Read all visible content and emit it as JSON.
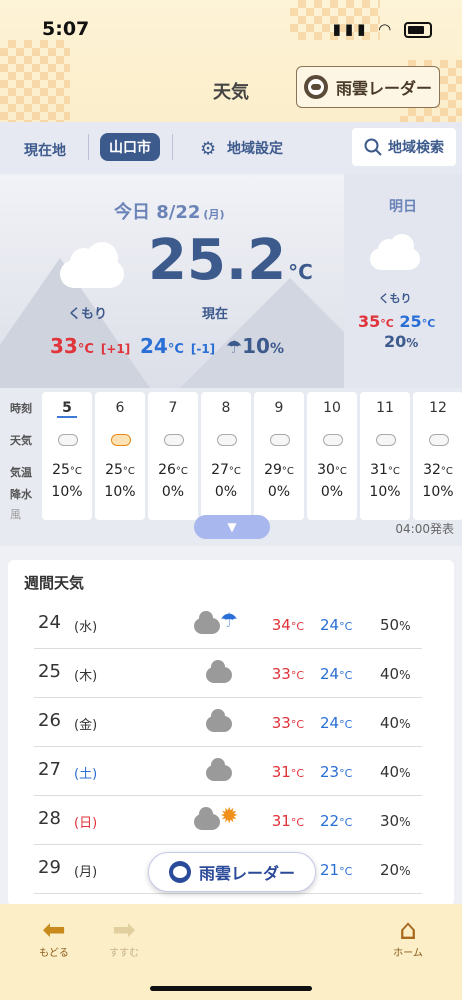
{
  "status": {
    "time": "5:07"
  },
  "header": {
    "title": "天気",
    "radar_label": "雨雲レーダー"
  },
  "location_bar": {
    "current": "現在地",
    "selected": "山口市",
    "settings": "地域設定",
    "search": "地域検索"
  },
  "today": {
    "date_label": "今日 8/22",
    "dow": "(月)",
    "weather": "くもり",
    "temp": "25.2",
    "temp_unit": "°C",
    "now_label": "現在",
    "high": "33",
    "high_diff": "[+1]",
    "low": "24",
    "low_diff": "[-1]",
    "pop": "10",
    "unit_c": "°C",
    "unit_pct": "%"
  },
  "tomorrow": {
    "label": "明日",
    "weather": "くもり",
    "high": "35",
    "low": "25",
    "pop": "20",
    "unit_c": "°C",
    "unit_pct": "%"
  },
  "hourly": {
    "row_labels": {
      "hour": "時刻",
      "weather": "天気",
      "temp": "気温",
      "rain": "降水",
      "wind": "風"
    },
    "hours": [
      {
        "hour": "5",
        "temp": "25",
        "rain": "10",
        "icon": "cloud-icon"
      },
      {
        "hour": "6",
        "temp": "25",
        "rain": "10",
        "icon": "sun-cloud-icon"
      },
      {
        "hour": "7",
        "temp": "26",
        "rain": "0",
        "icon": "cloud-icon"
      },
      {
        "hour": "8",
        "temp": "27",
        "rain": "0",
        "icon": "cloud-icon"
      },
      {
        "hour": "9",
        "temp": "29",
        "rain": "0",
        "icon": "cloud-icon"
      },
      {
        "hour": "10",
        "temp": "30",
        "rain": "0",
        "icon": "cloud-icon"
      },
      {
        "hour": "11",
        "temp": "31",
        "rain": "10",
        "icon": "cloud-icon"
      },
      {
        "hour": "12",
        "temp": "32",
        "rain": "10",
        "icon": "cloud-icon"
      }
    ],
    "temp_unit": "°C",
    "rain_unit": "%",
    "issued": "04:00発表"
  },
  "weekly": {
    "title": "週間天気",
    "days": [
      {
        "day": "24",
        "dow": "(水)",
        "high": "34",
        "low": "24",
        "pop": "50",
        "icon": "cloud-umbrella-icon",
        "dow_color": "#333333"
      },
      {
        "day": "25",
        "dow": "(木)",
        "high": "33",
        "low": "24",
        "pop": "40",
        "icon": "cloud-icon",
        "dow_color": "#333333"
      },
      {
        "day": "26",
        "dow": "(金)",
        "high": "33",
        "low": "24",
        "pop": "40",
        "icon": "cloud-icon",
        "dow_color": "#333333"
      },
      {
        "day": "27",
        "dow": "(土)",
        "high": "31",
        "low": "23",
        "pop": "40",
        "icon": "cloud-icon",
        "dow_color": "#2a6fd6"
      },
      {
        "day": "28",
        "dow": "(日)",
        "high": "31",
        "low": "22",
        "pop": "30",
        "icon": "cloud-sun-icon",
        "dow_color": "#e0333a"
      },
      {
        "day": "29",
        "dow": "(月)",
        "high": "",
        "low": "21",
        "pop": "20",
        "icon": "",
        "dow_color": "#333333"
      }
    ],
    "unit_c": "°C",
    "unit_pct": "%"
  },
  "floating": {
    "radar_label": "雨雲レーダー"
  },
  "footer": {
    "back": "もどる",
    "forward": "すすむ",
    "home": "ホーム"
  }
}
